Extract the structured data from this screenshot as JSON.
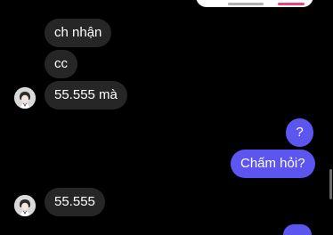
{
  "colors": {
    "background": "#000000",
    "incoming_bubble": "#262626",
    "outgoing_bubble": "#5c55f0",
    "text": "#ffffff"
  },
  "messages": [
    {
      "side": "incoming",
      "text": "ch nhận"
    },
    {
      "side": "incoming",
      "text": "cc"
    },
    {
      "side": "incoming",
      "text": "55.555 mà"
    },
    {
      "side": "outgoing",
      "text": "?"
    },
    {
      "side": "outgoing",
      "text": "Chấm hỏi?"
    },
    {
      "side": "incoming",
      "text": "55.555"
    }
  ],
  "icons": {
    "avatar": "contact-avatar-icon"
  }
}
